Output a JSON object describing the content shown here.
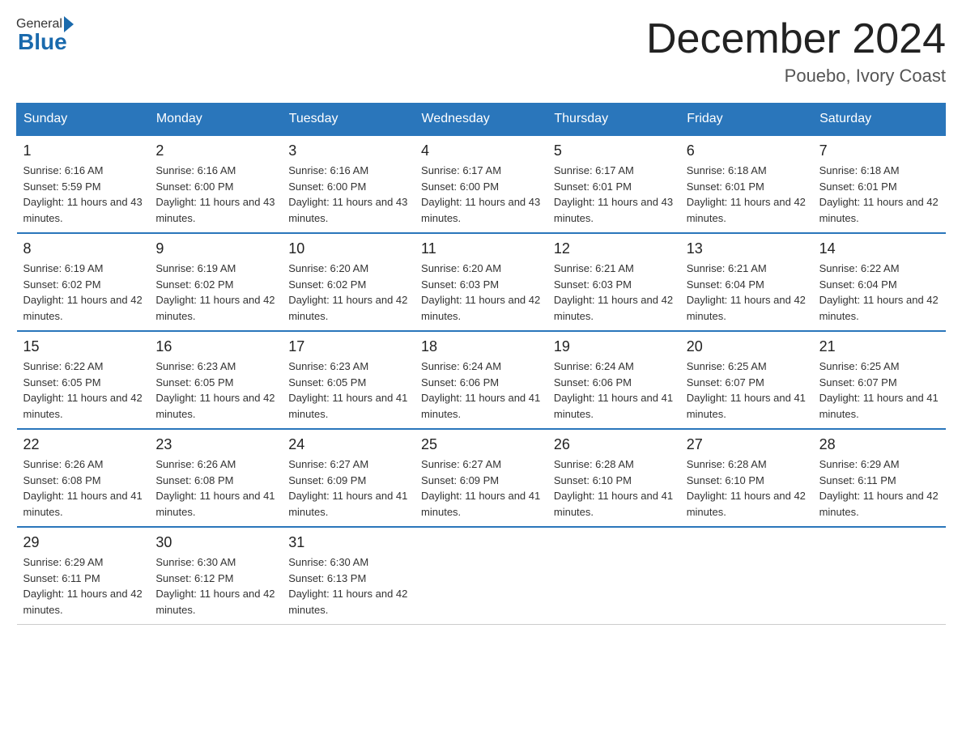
{
  "header": {
    "logo_general": "General",
    "logo_blue": "Blue",
    "month_title": "December 2024",
    "location": "Pouebo, Ivory Coast"
  },
  "days_of_week": [
    "Sunday",
    "Monday",
    "Tuesday",
    "Wednesday",
    "Thursday",
    "Friday",
    "Saturday"
  ],
  "weeks": [
    [
      {
        "day": "1",
        "sunrise": "Sunrise: 6:16 AM",
        "sunset": "Sunset: 5:59 PM",
        "daylight": "Daylight: 11 hours and 43 minutes."
      },
      {
        "day": "2",
        "sunrise": "Sunrise: 6:16 AM",
        "sunset": "Sunset: 6:00 PM",
        "daylight": "Daylight: 11 hours and 43 minutes."
      },
      {
        "day": "3",
        "sunrise": "Sunrise: 6:16 AM",
        "sunset": "Sunset: 6:00 PM",
        "daylight": "Daylight: 11 hours and 43 minutes."
      },
      {
        "day": "4",
        "sunrise": "Sunrise: 6:17 AM",
        "sunset": "Sunset: 6:00 PM",
        "daylight": "Daylight: 11 hours and 43 minutes."
      },
      {
        "day": "5",
        "sunrise": "Sunrise: 6:17 AM",
        "sunset": "Sunset: 6:01 PM",
        "daylight": "Daylight: 11 hours and 43 minutes."
      },
      {
        "day": "6",
        "sunrise": "Sunrise: 6:18 AM",
        "sunset": "Sunset: 6:01 PM",
        "daylight": "Daylight: 11 hours and 42 minutes."
      },
      {
        "day": "7",
        "sunrise": "Sunrise: 6:18 AM",
        "sunset": "Sunset: 6:01 PM",
        "daylight": "Daylight: 11 hours and 42 minutes."
      }
    ],
    [
      {
        "day": "8",
        "sunrise": "Sunrise: 6:19 AM",
        "sunset": "Sunset: 6:02 PM",
        "daylight": "Daylight: 11 hours and 42 minutes."
      },
      {
        "day": "9",
        "sunrise": "Sunrise: 6:19 AM",
        "sunset": "Sunset: 6:02 PM",
        "daylight": "Daylight: 11 hours and 42 minutes."
      },
      {
        "day": "10",
        "sunrise": "Sunrise: 6:20 AM",
        "sunset": "Sunset: 6:02 PM",
        "daylight": "Daylight: 11 hours and 42 minutes."
      },
      {
        "day": "11",
        "sunrise": "Sunrise: 6:20 AM",
        "sunset": "Sunset: 6:03 PM",
        "daylight": "Daylight: 11 hours and 42 minutes."
      },
      {
        "day": "12",
        "sunrise": "Sunrise: 6:21 AM",
        "sunset": "Sunset: 6:03 PM",
        "daylight": "Daylight: 11 hours and 42 minutes."
      },
      {
        "day": "13",
        "sunrise": "Sunrise: 6:21 AM",
        "sunset": "Sunset: 6:04 PM",
        "daylight": "Daylight: 11 hours and 42 minutes."
      },
      {
        "day": "14",
        "sunrise": "Sunrise: 6:22 AM",
        "sunset": "Sunset: 6:04 PM",
        "daylight": "Daylight: 11 hours and 42 minutes."
      }
    ],
    [
      {
        "day": "15",
        "sunrise": "Sunrise: 6:22 AM",
        "sunset": "Sunset: 6:05 PM",
        "daylight": "Daylight: 11 hours and 42 minutes."
      },
      {
        "day": "16",
        "sunrise": "Sunrise: 6:23 AM",
        "sunset": "Sunset: 6:05 PM",
        "daylight": "Daylight: 11 hours and 42 minutes."
      },
      {
        "day": "17",
        "sunrise": "Sunrise: 6:23 AM",
        "sunset": "Sunset: 6:05 PM",
        "daylight": "Daylight: 11 hours and 41 minutes."
      },
      {
        "day": "18",
        "sunrise": "Sunrise: 6:24 AM",
        "sunset": "Sunset: 6:06 PM",
        "daylight": "Daylight: 11 hours and 41 minutes."
      },
      {
        "day": "19",
        "sunrise": "Sunrise: 6:24 AM",
        "sunset": "Sunset: 6:06 PM",
        "daylight": "Daylight: 11 hours and 41 minutes."
      },
      {
        "day": "20",
        "sunrise": "Sunrise: 6:25 AM",
        "sunset": "Sunset: 6:07 PM",
        "daylight": "Daylight: 11 hours and 41 minutes."
      },
      {
        "day": "21",
        "sunrise": "Sunrise: 6:25 AM",
        "sunset": "Sunset: 6:07 PM",
        "daylight": "Daylight: 11 hours and 41 minutes."
      }
    ],
    [
      {
        "day": "22",
        "sunrise": "Sunrise: 6:26 AM",
        "sunset": "Sunset: 6:08 PM",
        "daylight": "Daylight: 11 hours and 41 minutes."
      },
      {
        "day": "23",
        "sunrise": "Sunrise: 6:26 AM",
        "sunset": "Sunset: 6:08 PM",
        "daylight": "Daylight: 11 hours and 41 minutes."
      },
      {
        "day": "24",
        "sunrise": "Sunrise: 6:27 AM",
        "sunset": "Sunset: 6:09 PM",
        "daylight": "Daylight: 11 hours and 41 minutes."
      },
      {
        "day": "25",
        "sunrise": "Sunrise: 6:27 AM",
        "sunset": "Sunset: 6:09 PM",
        "daylight": "Daylight: 11 hours and 41 minutes."
      },
      {
        "day": "26",
        "sunrise": "Sunrise: 6:28 AM",
        "sunset": "Sunset: 6:10 PM",
        "daylight": "Daylight: 11 hours and 41 minutes."
      },
      {
        "day": "27",
        "sunrise": "Sunrise: 6:28 AM",
        "sunset": "Sunset: 6:10 PM",
        "daylight": "Daylight: 11 hours and 42 minutes."
      },
      {
        "day": "28",
        "sunrise": "Sunrise: 6:29 AM",
        "sunset": "Sunset: 6:11 PM",
        "daylight": "Daylight: 11 hours and 42 minutes."
      }
    ],
    [
      {
        "day": "29",
        "sunrise": "Sunrise: 6:29 AM",
        "sunset": "Sunset: 6:11 PM",
        "daylight": "Daylight: 11 hours and 42 minutes."
      },
      {
        "day": "30",
        "sunrise": "Sunrise: 6:30 AM",
        "sunset": "Sunset: 6:12 PM",
        "daylight": "Daylight: 11 hours and 42 minutes."
      },
      {
        "day": "31",
        "sunrise": "Sunrise: 6:30 AM",
        "sunset": "Sunset: 6:13 PM",
        "daylight": "Daylight: 11 hours and 42 minutes."
      },
      null,
      null,
      null,
      null
    ]
  ]
}
